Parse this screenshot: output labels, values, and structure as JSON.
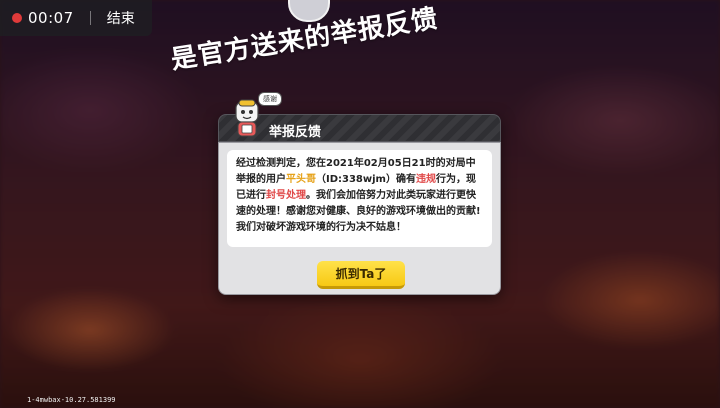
{
  "recorder": {
    "time": "00:07",
    "end_label": "结束",
    "rec_color": "#e03a3a"
  },
  "caption": "是官方送来的举报反馈",
  "dialog": {
    "title": "举报反馈",
    "bubble": "感谢",
    "message": {
      "part1": "经过检测判定，您在2021年02月05日21时的对局中举报的用户",
      "player": "平头哥",
      "part2": "（ID:338wjm）确有",
      "violation": "违规",
      "part3": "行为，现已进行",
      "penalty": "封号处理",
      "part4": "。我们会加倍努力对此类玩家进行更快速的处理！感谢您对健康、良好的游戏环境做出的贡献!我们对破坏游戏环境的行为决不姑息！"
    },
    "button_label": "抓到Ta了",
    "accent_yellow": "#e6a21a",
    "accent_red": "#e04848"
  },
  "watermark": "1-4mwbax-10.27.581399"
}
